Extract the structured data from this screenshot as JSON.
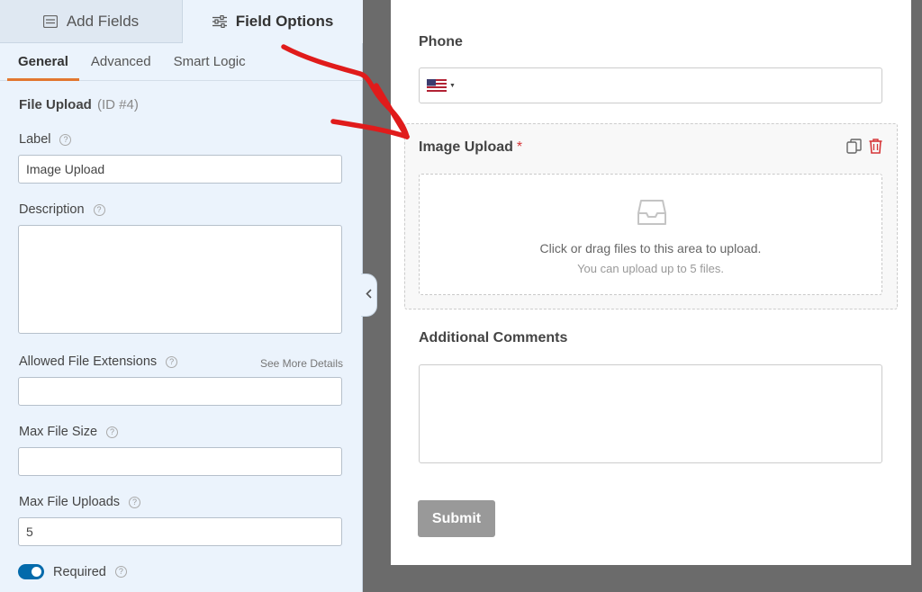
{
  "top_tabs": [
    {
      "label": "Add Fields",
      "icon": "list-icon"
    },
    {
      "label": "Field Options",
      "icon": "sliders-icon"
    }
  ],
  "sub_tabs": [
    {
      "label": "General",
      "active": true
    },
    {
      "label": "Advanced"
    },
    {
      "label": "Smart Logic"
    }
  ],
  "field_options": {
    "field_type": "File Upload",
    "field_id": "(ID #4)",
    "label_label": "Label",
    "label_value": "Image Upload",
    "description_label": "Description",
    "extensions_label": "Allowed File Extensions",
    "see_more": "See More Details",
    "max_size_label": "Max File Size",
    "max_uploads_label": "Max File Uploads",
    "max_uploads_value": "5",
    "required_label": "Required",
    "required_on": true
  },
  "preview": {
    "phone_label": "Phone",
    "upload_label": "Image Upload",
    "required_mark": "*",
    "drop_text": "Click or drag files to this area to upload.",
    "drop_hint": "You can upload up to 5 files.",
    "comments_label": "Additional Comments",
    "submit_label": "Submit"
  },
  "colors": {
    "accent_tab_underline": "#e27730",
    "toggle_on": "#036aab",
    "delete_icon": "#d63638",
    "annotation_arrow": "#e01b1b"
  }
}
